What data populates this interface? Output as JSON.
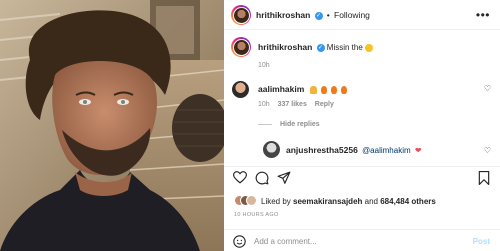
{
  "post": {
    "username": "hrithikroshan",
    "separator": "•",
    "follow_label": "Following",
    "more_label": "•••",
    "caption_user": "hrithikroshan",
    "caption_text": "Missin the",
    "caption_time": "10h"
  },
  "comments": [
    {
      "username": "aalimhakim",
      "text": "",
      "time": "10h",
      "likes": "337 likes",
      "reply_label": "Reply",
      "hide_replies": "Hide replies"
    },
    {
      "username": "anjushrestha5256",
      "mention": "@aalimhakim",
      "emoji": "❤"
    }
  ],
  "likes_line": {
    "prefix": "Liked by",
    "user": "seemakiransajdeh",
    "middle": "and",
    "count": "684,484 others"
  },
  "timestamp": "10 HOURS AGO",
  "add_comment": {
    "placeholder": "Add a comment...",
    "post_label": "Post"
  },
  "colors": {
    "verified": "#3897f0",
    "heart_red": "#ed4956",
    "muted": "#8e8e8e",
    "post_disabled": "#b2dffc"
  }
}
